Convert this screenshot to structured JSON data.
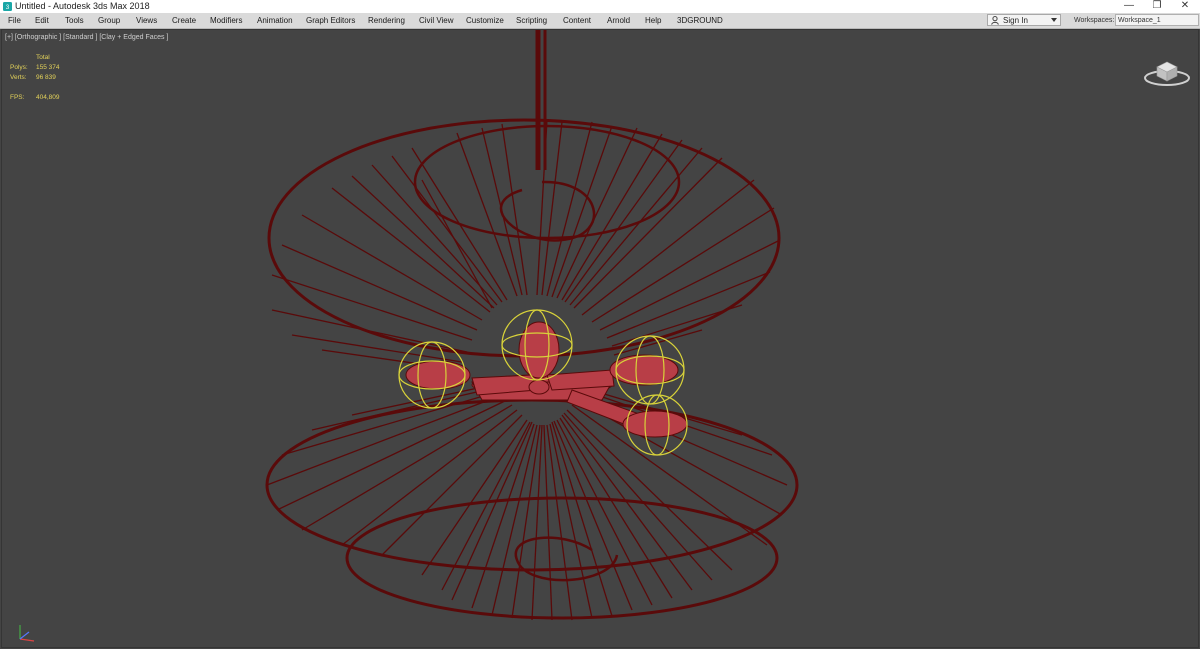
{
  "titlebar": {
    "title": "Untitled - Autodesk 3ds Max 2018",
    "minimize_label": "—",
    "restore_label": "❐",
    "close_label": "✕",
    "app_icon": "3ds-max-app-icon"
  },
  "menubar": {
    "items": [
      "File",
      "Edit",
      "Tools",
      "Group",
      "Views",
      "Create",
      "Modifiers",
      "Animation",
      "Graph Editors",
      "Rendering",
      "Civil View",
      "Customize",
      "Scripting",
      "Content",
      "Arnold",
      "Help",
      "3DGROUND"
    ],
    "signin_label": "Sign In",
    "workspaces_label": "Workspaces:",
    "workspace_value": "Workspace_1"
  },
  "viewport": {
    "label": "[+] [Orthographic ] [Standard ] [Clay + Edged Faces ]",
    "stats": {
      "total_label": "Total",
      "polys_label": "Polys:",
      "polys_value": "155 374",
      "verts_label": "Verts:",
      "verts_value": "96 839",
      "fps_label": "FPS:",
      "fps_value": "404,809"
    },
    "colors": {
      "background": "#444444",
      "wire": "#5a0a0a",
      "clay": "#c0424a",
      "helper": "#d8d23a",
      "stats_text": "#e3d25a"
    }
  }
}
